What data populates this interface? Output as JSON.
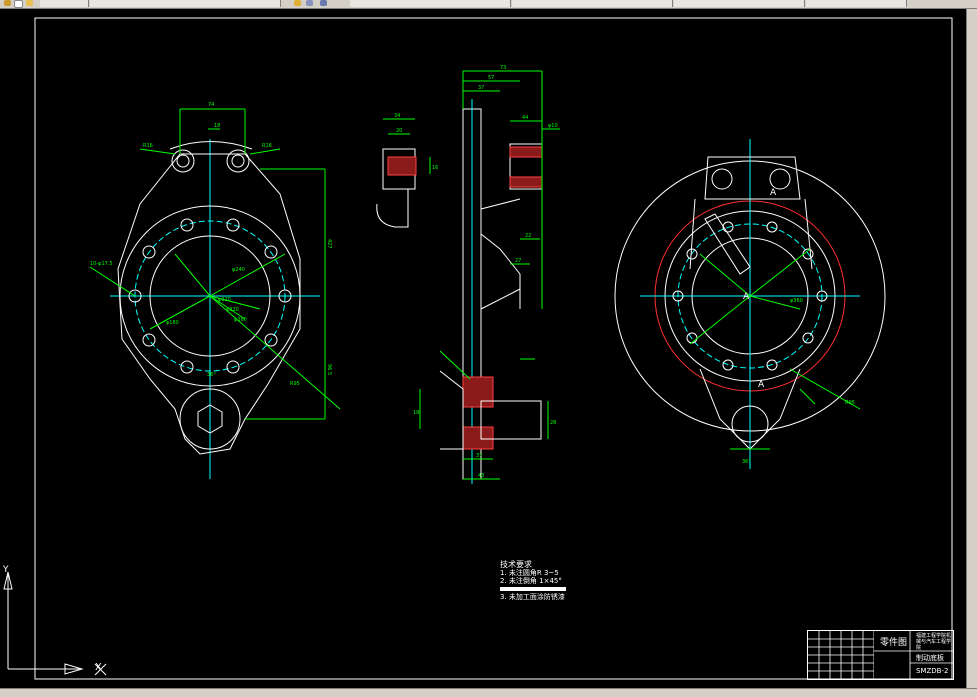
{
  "toolbar": {
    "segments": [
      "",
      "",
      "",
      "",
      "",
      ""
    ]
  },
  "drawing": {
    "dims": {
      "front_top_width": "74",
      "front_top_sub": "18",
      "front_radius_tl": "R16",
      "front_radius_tr": "R16",
      "front_height_total": "427",
      "front_height_lower": "96.5",
      "front_bolt_circle": "φ320",
      "front_left_dim": "10-φ17.5",
      "front_d1": "φ240",
      "front_d2": "φ320",
      "front_d3": "φ180",
      "front_d4": "φ360",
      "front_angle": "36°",
      "front_side": "R95",
      "side_top": "73",
      "side_sub1": "57",
      "side_sub2": "37",
      "side_w1": "34",
      "side_w2": "20",
      "side_h1": "16",
      "side_r": "φ8",
      "side_44": "44",
      "side_phi": "φ10",
      "side_22": "22",
      "side_27": "27",
      "side_37": "37",
      "side_43": "43",
      "side_18": "18",
      "side_28": "28",
      "side_bottom_37": "37",
      "side_bottom_43": "43",
      "right_A_label": "A",
      "right_A2_label": "A",
      "right_A3_label": "A",
      "right_angle": "36°",
      "right_R": "R95",
      "right_phi": "φ360"
    },
    "notes": {
      "title": "技术要求",
      "lines": [
        "1. 未注圆角R 3~5",
        "2. 未注倒角 1×45°",
        "",
        "3. 未加工面涂防锈漆"
      ]
    },
    "title_block": {
      "part_name": "零件图",
      "school": "福建工程学院机械与汽车工程学院",
      "group": "制动底板",
      "code": "SMZDB-2",
      "scale_label": "",
      "qty_label": ""
    },
    "ucs": {
      "y_label": "Y",
      "x_label": "X"
    }
  },
  "colors": {
    "background": "#000000",
    "outline": "#ffffff",
    "center_lines": "#00ffff",
    "dimensions": "#00ff00",
    "section_hatch": "#ff0000",
    "chrome": "#d4d0c8"
  }
}
